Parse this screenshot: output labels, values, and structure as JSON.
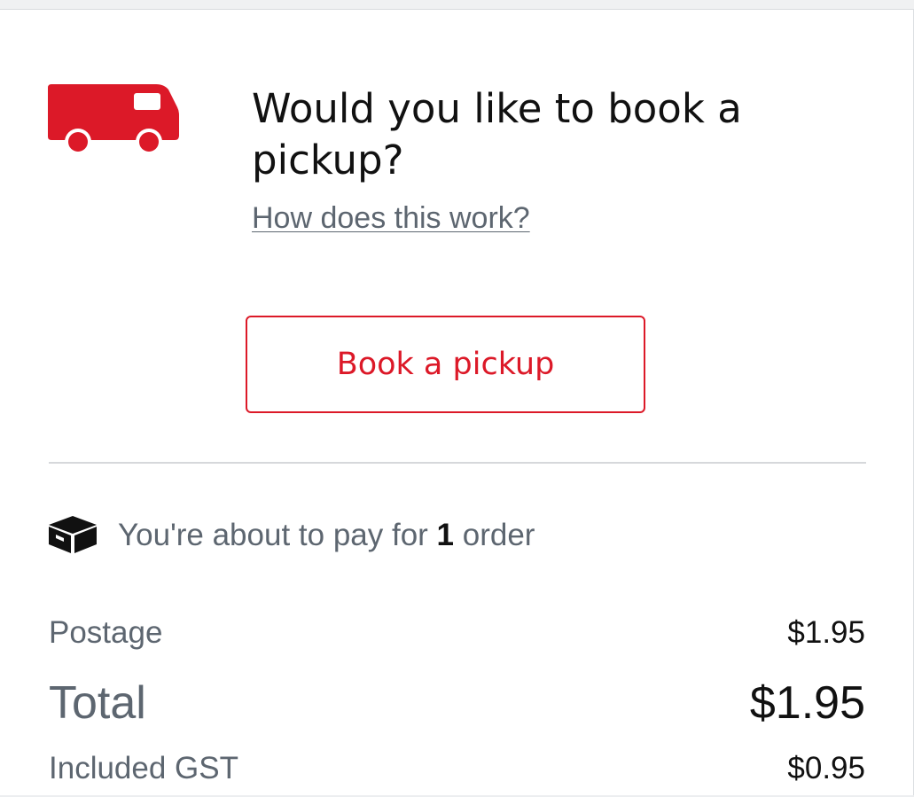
{
  "pickup": {
    "title": "Would you like to book a pickup?",
    "help_link": "How does this work?",
    "book_button": "Book a pickup",
    "icon": "truck-icon"
  },
  "order": {
    "prefix": "You're about to pay for ",
    "count": "1",
    "suffix": " order",
    "icon": "box-icon"
  },
  "summary": {
    "postage_label": "Postage",
    "postage_value": "$1.95",
    "total_label": "Total",
    "total_value": "$1.95",
    "gst_label": "Included GST",
    "gst_value": "$0.95"
  },
  "colors": {
    "accent_red": "#dc1928",
    "muted_text": "#5d6670",
    "text": "#111111",
    "divider": "#d6d8db"
  }
}
